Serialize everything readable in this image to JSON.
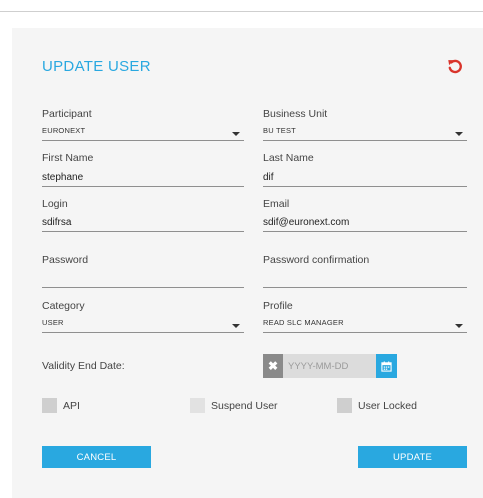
{
  "form": {
    "title": "UPDATE USER",
    "reset_icon": "undo-icon"
  },
  "fields": {
    "participant": {
      "label": "Participant",
      "value": "EURONEXT"
    },
    "business_unit": {
      "label": "Business Unit",
      "value": "BU TEST"
    },
    "first_name": {
      "label": "First Name",
      "value": "stephane"
    },
    "last_name": {
      "label": "Last Name",
      "value": "dif"
    },
    "login": {
      "label": "Login",
      "value": "sdifrsa"
    },
    "email": {
      "label": "Email",
      "value": "sdif@euronext.com"
    },
    "password": {
      "label": "Password",
      "value": ""
    },
    "password_confirmation": {
      "label": "Password confirmation",
      "value": ""
    },
    "category": {
      "label": "Category",
      "value": "USER"
    },
    "profile": {
      "label": "Profile",
      "value": "READ SLC MANAGER"
    },
    "validity_end_date": {
      "label": "Validity End Date:",
      "placeholder": "YYYY-MM-DD"
    }
  },
  "checkboxes": {
    "api": "API",
    "suspend_user": "Suspend User",
    "user_locked": "User Locked"
  },
  "buttons": {
    "cancel": "CANCEL",
    "update": "UPDATE"
  },
  "colors": {
    "accent": "#29a8e0",
    "reset_icon": "#d9342b"
  }
}
